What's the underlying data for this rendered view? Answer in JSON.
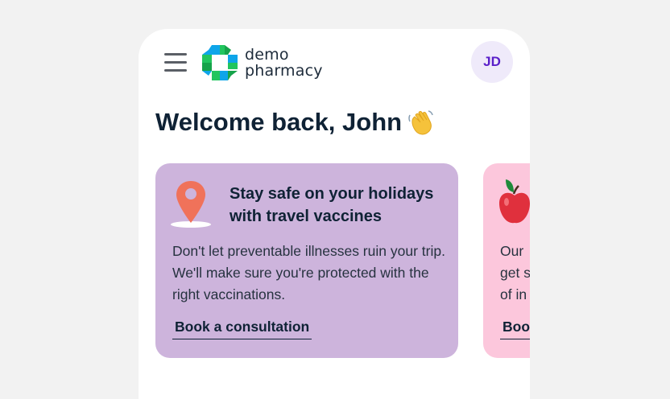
{
  "header": {
    "logo_line1": "demo",
    "logo_line2": "pharmacy",
    "avatar_initials": "JD"
  },
  "welcome": {
    "title": "Welcome back, John"
  },
  "cards": [
    {
      "title": "Stay safe on your holidays with travel vaccines",
      "body": "Don't let preventable illnesses ruin your trip. We'll make sure you're protected with the right vaccinations.",
      "link": "Book a consultation",
      "background": "#cdb4dc",
      "icon": "map-pin-icon"
    },
    {
      "body_lines": [
        "Our",
        "get s",
        "of in"
      ],
      "link": "Boo",
      "background": "#fcc7dc",
      "icon": "apple-icon"
    }
  ],
  "colors": {
    "page_bg": "#f2f2f2",
    "heading": "#0f2235",
    "avatar_bg": "#efeafa",
    "avatar_text": "#5a1fc9",
    "logo_green": "#22c55e",
    "logo_blue": "#0ea5e9"
  }
}
